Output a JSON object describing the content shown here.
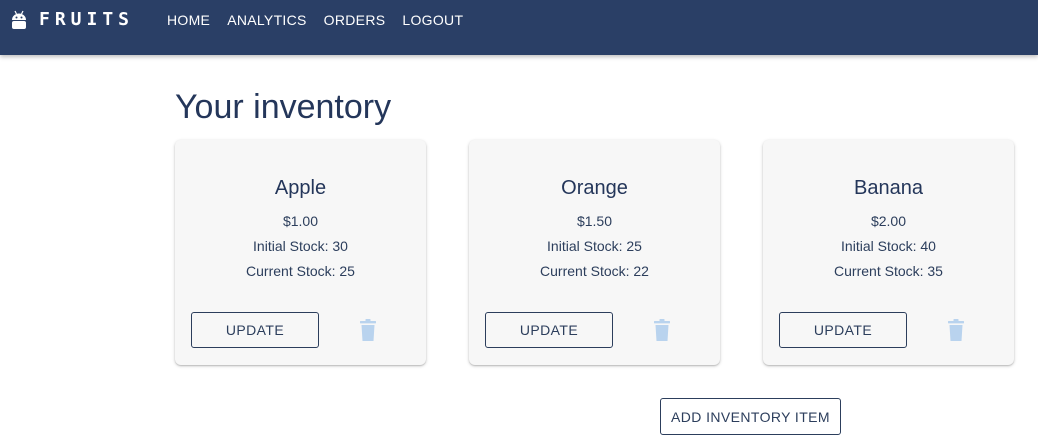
{
  "brand": {
    "name": "FRUITS",
    "logo_icon": "android-robot-icon"
  },
  "nav": {
    "items": [
      {
        "label": "HOME"
      },
      {
        "label": "ANALYTICS"
      },
      {
        "label": "ORDERS"
      },
      {
        "label": "LOGOUT"
      }
    ]
  },
  "main": {
    "title": "Your inventory",
    "cards": [
      {
        "name": "Apple",
        "price": "$1.00",
        "initial_stock": "Initial Stock: 30",
        "current_stock": "Current Stock: 25",
        "update_label": "UPDATE",
        "delete_icon": "trash-icon"
      },
      {
        "name": "Orange",
        "price": "$1.50",
        "initial_stock": "Initial Stock: 25",
        "current_stock": "Current Stock: 22",
        "update_label": "UPDATE",
        "delete_icon": "trash-icon"
      },
      {
        "name": "Banana",
        "price": "$2.00",
        "initial_stock": "Initial Stock: 40",
        "current_stock": "Current Stock: 35",
        "update_label": "UPDATE",
        "delete_icon": "trash-icon"
      }
    ],
    "add_label": "ADD INVENTORY ITEM"
  },
  "colors": {
    "appbar": "#2a3f66",
    "primary_text": "#24365a",
    "card_bg": "#f7f7f7",
    "trash_icon": "#b9d3ee"
  }
}
